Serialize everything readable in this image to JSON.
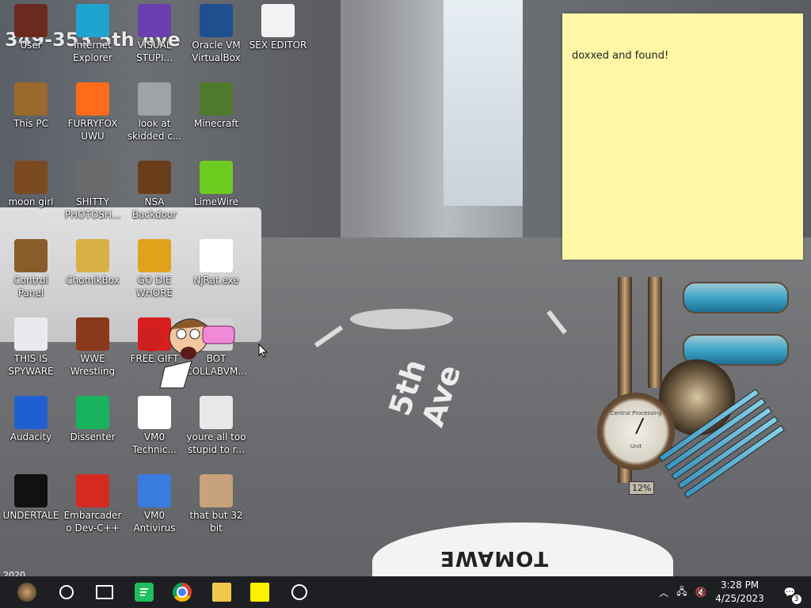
{
  "wallpaper": {
    "street_sign_text": "5th Ave",
    "address_text": "349-353 5th Ave",
    "year_watermark": "2020",
    "car_brand_text": "TOMAWE"
  },
  "desktop_icons": [
    {
      "label": "User",
      "icon": "user-folder-icon",
      "color": "#6b2a1e"
    },
    {
      "label": "Internet Explorer",
      "icon": "edge-icon",
      "color": "#1fa3d1"
    },
    {
      "label": "VISUAL STUPI...",
      "icon": "visual-studio-icon",
      "color": "#6b3fb0"
    },
    {
      "label": "Oracle VM VirtualBox",
      "icon": "virtualbox-icon",
      "color": "#1e4f8f"
    },
    {
      "label": "SEX EDITOR",
      "icon": "hxd-icon",
      "color": "#f2f2f2"
    },
    {
      "label": "This PC",
      "icon": "this-pc-icon",
      "color": "#9a6a2d"
    },
    {
      "label": "FURRYFOX UWU",
      "icon": "firefox-icon",
      "color": "#ff6b1a"
    },
    {
      "label": "look at skidded c...",
      "icon": "copy-files-icon",
      "color": "#9ea3a8"
    },
    {
      "label": "Minecraft",
      "icon": "minecraft-icon",
      "color": "#4f7a2b"
    },
    {
      "label": "moon girl",
      "icon": "moon-girl-icon",
      "color": "#7b4a20"
    },
    {
      "label": "SHITTY PHOTOSH...",
      "icon": "gimp-icon",
      "color": "#6a6a6a"
    },
    {
      "label": "NSA Backdoor",
      "icon": "nsa-backdoor-icon",
      "color": "#6a3e1a"
    },
    {
      "label": "LimeWire",
      "icon": "limewire-icon",
      "color": "#6ecb1f"
    },
    {
      "label": "Control Panel",
      "icon": "control-panel-icon",
      "color": "#8a5c2a"
    },
    {
      "label": "ChomikBox",
      "icon": "chomikbox-icon",
      "color": "#d8b146"
    },
    {
      "label": "GO DIE WHORE",
      "icon": "godie-icon",
      "color": "#e0a21b"
    },
    {
      "label": "NjRat.exe",
      "icon": "skull-icon",
      "color": "#ffffff"
    },
    {
      "label": "THIS IS SPYWARE",
      "icon": "chrome-icon",
      "color": "#e8eaed"
    },
    {
      "label": "WWE Wrestling",
      "icon": "wwe-icon",
      "color": "#8a3a1a"
    },
    {
      "label": "FREE GIFT",
      "icon": "gift-icon",
      "color": "#d91e1e"
    },
    {
      "label": "BOT COLLABVM...",
      "icon": "collabvm-icon",
      "color": "#d3d3d3"
    },
    {
      "label": "Audacity",
      "icon": "audacity-icon",
      "color": "#1f5fd1"
    },
    {
      "label": "Dissenter",
      "icon": "dissenter-icon",
      "color": "#18b35c"
    },
    {
      "label": "VM0 Technic...",
      "icon": "technician-icon",
      "color": "#ffffff"
    },
    {
      "label": "youre all too stupid to r...",
      "icon": "portrait-icon",
      "color": "#e8e8e8"
    },
    {
      "label": "UNDERTALE",
      "icon": "unity-icon",
      "color": "#111111"
    },
    {
      "label": "Embarcadero Dev-C++",
      "icon": "devcpp-icon",
      "color": "#d62a20"
    },
    {
      "label": "VM0 Antivirus",
      "icon": "shield-icon",
      "color": "#3a7be0"
    },
    {
      "label": "that but 32 bit",
      "icon": "portrait-woman-icon",
      "color": "#c7a27a"
    }
  ],
  "sticky_note": {
    "text": "doxxed and found!"
  },
  "steam_gadget": {
    "percent_label": "12%",
    "gauge_text_top": "Central Processing",
    "gauge_text_bottom": "Unit"
  },
  "taskbar": {
    "items": [
      {
        "name": "start",
        "icon": "steampunk-start-icon"
      },
      {
        "name": "search",
        "icon": "search-circle-icon"
      },
      {
        "name": "task-view",
        "icon": "task-view-icon"
      },
      {
        "name": "dissenter",
        "icon": "dissenter-taskbar-icon"
      },
      {
        "name": "chrome",
        "icon": "chrome-taskbar-icon"
      },
      {
        "name": "file-explorer",
        "icon": "folder-taskbar-icon"
      },
      {
        "name": "sticky-notes",
        "icon": "sticky-notes-taskbar-icon"
      },
      {
        "name": "webcam",
        "icon": "webcam-taskbar-icon"
      }
    ],
    "tray": {
      "chevron_icon": "chevron-up-icon",
      "network_icon": "network-icon",
      "volume_icon": "volume-muted-icon"
    },
    "clock": {
      "time": "3:28 PM",
      "date": "4/25/2023"
    },
    "notification_count": "3"
  }
}
